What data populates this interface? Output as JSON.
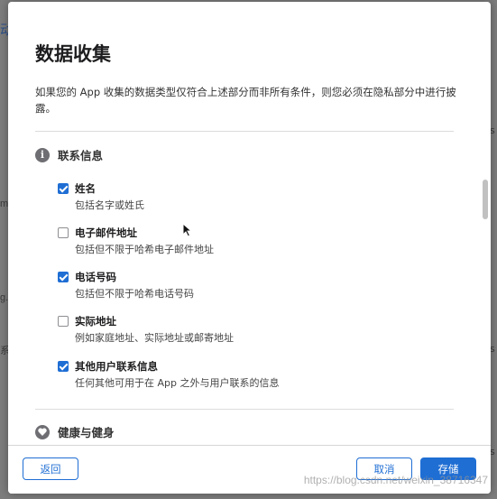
{
  "background": {
    "left_fragments": [
      "动",
      "m",
      "g.",
      "系"
    ],
    "right_fragments": [
      "s",
      "s",
      "s"
    ]
  },
  "modal": {
    "title": "数据收集",
    "description": "如果您的 App 收集的数据类型仅符合上述部分而非所有条件，则您必须在隐私部分中进行披露。",
    "sections": [
      {
        "icon": "info-icon",
        "icon_glyph": "i",
        "title": "联系信息",
        "items": [
          {
            "title": "姓名",
            "subtitle": "包括名字或姓氏",
            "checked": true
          },
          {
            "title": "电子邮件地址",
            "subtitle": "包括但不限于哈希电子邮件地址",
            "checked": false
          },
          {
            "title": "电话号码",
            "subtitle": "包括但不限于哈希电话号码",
            "checked": true
          },
          {
            "title": "实际地址",
            "subtitle": "例如家庭地址、实际地址或邮寄地址",
            "checked": false
          },
          {
            "title": "其他用户联系信息",
            "subtitle": "任何其他可用于在 App 之外与用户联系的信息",
            "checked": true
          }
        ]
      },
      {
        "icon": "heart-icon",
        "title": "健康与健身"
      }
    ]
  },
  "footer": {
    "back_label": "返回",
    "cancel_label": "取消",
    "save_label": "存储"
  },
  "watermark": "https://blog.csdn.net/weixin_38716347",
  "colors": {
    "accent": "#1f6ed4",
    "overlay": "#7d7d7d"
  }
}
